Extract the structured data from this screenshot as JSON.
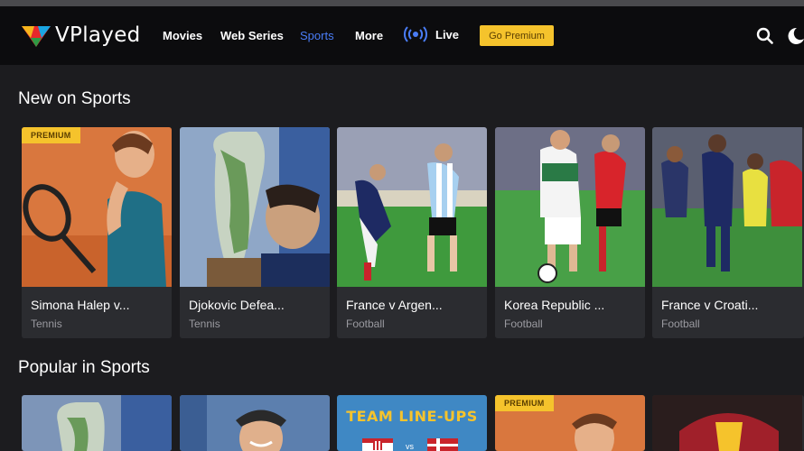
{
  "brand": {
    "name": "VPlayed"
  },
  "nav": {
    "items": [
      "Movies",
      "Web Series",
      "Sports",
      "More"
    ],
    "live_label": "Live",
    "premium_label": "Go Premium"
  },
  "sections": [
    {
      "title": "New on Sports",
      "cards": [
        {
          "title": "Simona Halep v...",
          "genre": "Tennis",
          "badge": "PREMIUM"
        },
        {
          "title": "Djokovic Defea...",
          "genre": "Tennis",
          "badge": ""
        },
        {
          "title": "France v Argen...",
          "genre": "Football",
          "badge": ""
        },
        {
          "title": "Korea Republic ...",
          "genre": "Football",
          "badge": ""
        },
        {
          "title": "France v Croati...",
          "genre": "Football",
          "badge": ""
        }
      ]
    },
    {
      "title": "Popular in Sports",
      "cards": [
        {
          "title": "",
          "genre": "",
          "badge": ""
        },
        {
          "title": "",
          "genre": "",
          "badge": ""
        },
        {
          "title": "TEAM LINE-UPS",
          "genre": "",
          "badge": ""
        },
        {
          "title": "",
          "genre": "",
          "badge": "PREMIUM"
        },
        {
          "title": "",
          "genre": "",
          "badge": ""
        }
      ]
    }
  ],
  "colors": {
    "accent": "#4a7df7",
    "premium": "#f5c32c",
    "background": "#1c1c1f",
    "navbar": "#0c0c0e"
  },
  "icons": {
    "search": "search-icon",
    "theme": "moon-icon",
    "live": "broadcast-icon"
  }
}
